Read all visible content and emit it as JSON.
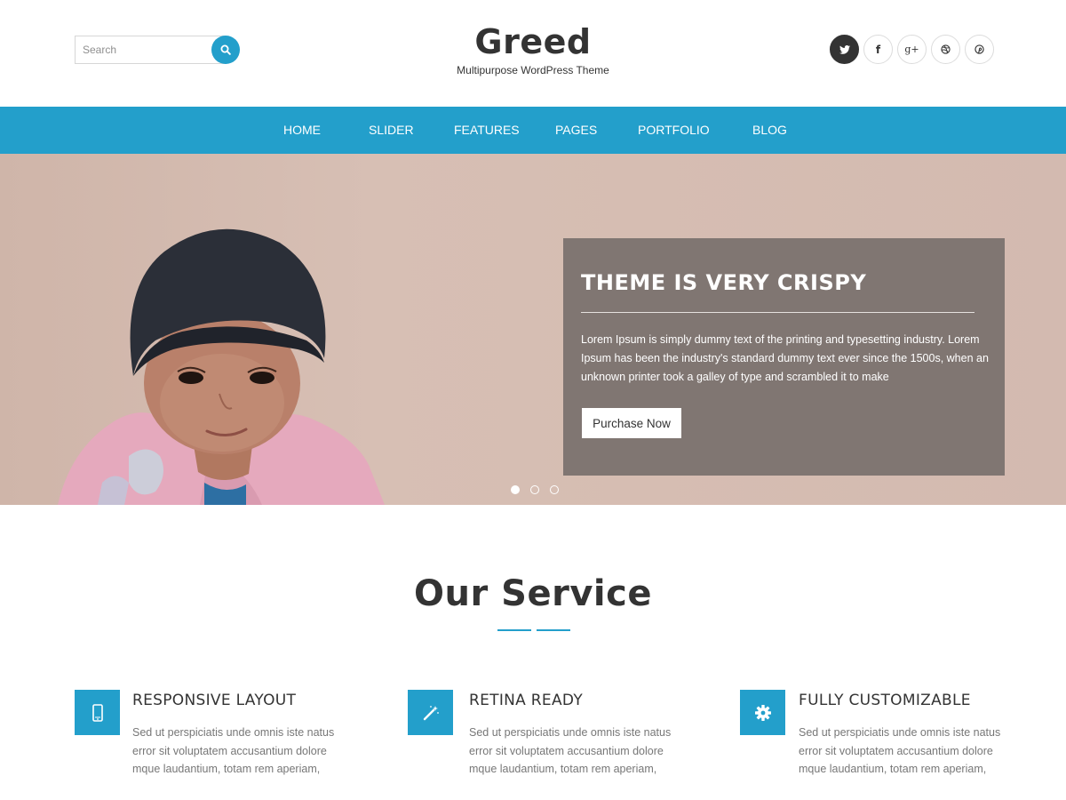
{
  "header": {
    "search": {
      "placeholder": "Search",
      "value": ""
    },
    "logo": {
      "title": "Greed",
      "tagline": "Multipurpose WordPress Theme"
    },
    "social": [
      {
        "icon": "twitter-icon",
        "glyph": "🐦"
      },
      {
        "icon": "facebook-icon",
        "glyph": "f"
      },
      {
        "icon": "google-plus-icon",
        "glyph": "g+"
      },
      {
        "icon": "dribbble-icon",
        "glyph": "◎"
      },
      {
        "icon": "pinterest-icon",
        "glyph": "℗"
      }
    ]
  },
  "nav": {
    "items": [
      "HOME",
      "SLIDER",
      "FEATURES",
      "PAGES",
      "PORTFOLIO",
      "BLOG"
    ]
  },
  "hero": {
    "title": "THEME IS VERY CRISPY",
    "text": "Lorem Ipsum is simply dummy text of the printing and typesetting industry. Lorem Ipsum has been the industry's standard dummy text ever since the 1500s, when an unknown printer took a galley of type and scrambled it to make",
    "cta": "Purchase Now",
    "slides": 3,
    "active_slide": 1
  },
  "services": {
    "title": "Our Service",
    "items": [
      {
        "icon": "mobile-phone-icon",
        "title": "RESPONSIVE LAYOUT",
        "text": "Sed ut perspiciatis unde omnis iste natus error sit voluptatem accusantium dolore mque laudantium, totam rem aperiam,"
      },
      {
        "icon": "magic-wand-icon",
        "title": "RETINA READY",
        "text": "Sed ut perspiciatis unde omnis iste natus error sit voluptatem accusantium dolore mque laudantium, totam rem aperiam,"
      },
      {
        "icon": "gear-icon",
        "title": "FULLY CUSTOMIZABLE",
        "text": "Sed ut perspiciatis unde omnis iste natus error sit voluptatem accusantium dolore mque laudantium, totam rem aperiam,"
      }
    ]
  },
  "colors": {
    "accent": "#239fcb",
    "hero_bg": "#d4bcb1",
    "hero_box": "#7a716d",
    "text_dark": "#333333",
    "text_muted": "#777777"
  }
}
